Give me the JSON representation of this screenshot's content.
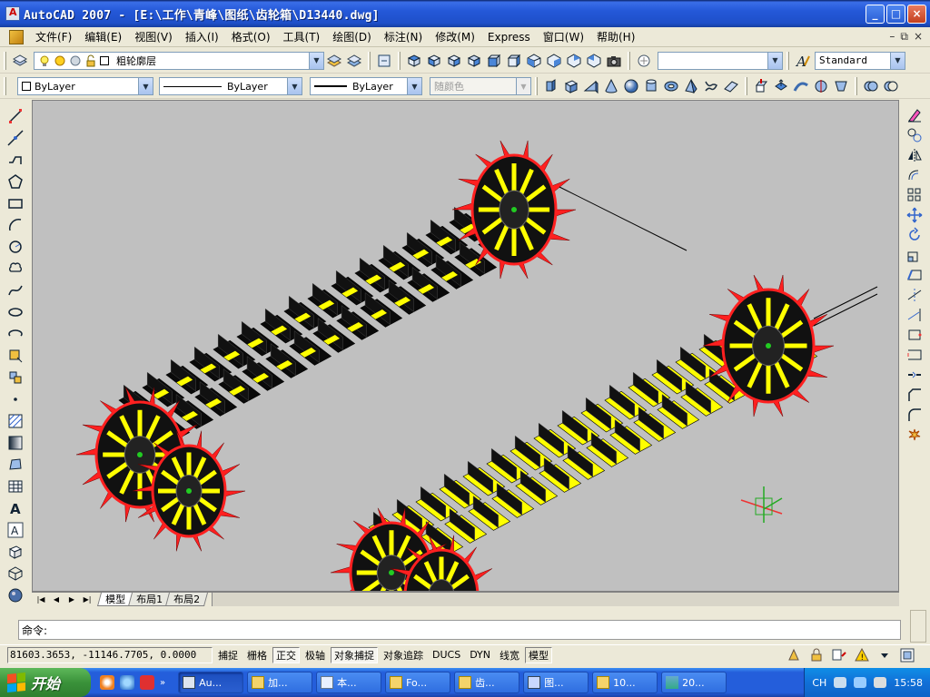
{
  "window": {
    "title": "AutoCAD 2007 - [E:\\工作\\青峰\\图纸\\齿轮箱\\D13440.dwg]",
    "buttons": [
      "_",
      "□",
      "×"
    ]
  },
  "menu": {
    "items": [
      "文件(F)",
      "编辑(E)",
      "视图(V)",
      "插入(I)",
      "格式(O)",
      "工具(T)",
      "绘图(D)",
      "标注(N)",
      "修改(M)",
      "Express",
      "窗口(W)",
      "帮助(H)"
    ],
    "mdi_buttons": [
      "–",
      "⧉",
      "×"
    ]
  },
  "layers": {
    "current": "粗轮廓层"
  },
  "toolbar1": {
    "view_combo": "",
    "text_style": "Standard"
  },
  "properties": {
    "color": "ByLayer",
    "linetype": "ByLayer",
    "lineweight": "ByLayer",
    "plotstyle": "随颜色"
  },
  "tabs": {
    "items": [
      "模型",
      "布局1",
      "布局2"
    ],
    "active": 0
  },
  "command": {
    "prompt": "命令:"
  },
  "status": {
    "coords": "81603.3653, -11146.7705, 0.0000",
    "buttons": [
      "捕捉",
      "栅格",
      "正交",
      "极轴",
      "对象捕捉",
      "对象追踪",
      "DUCS",
      "DYN",
      "线宽",
      "模型"
    ],
    "on_states": [
      false,
      false,
      true,
      false,
      true,
      false,
      false,
      false,
      false,
      true
    ]
  },
  "taskbar": {
    "start": "开始",
    "tasks": [
      "Au...",
      "加...",
      "本...",
      "Fo...",
      "齿...",
      "图...",
      "10...",
      "20..."
    ],
    "lang": "CH",
    "clock": "15:58"
  },
  "colors": {
    "canvas_bg": "#c0c0c0",
    "track_black": "#0a0a0a",
    "track_yellow": "#ffff00",
    "sprocket_red": "#ff2020"
  }
}
